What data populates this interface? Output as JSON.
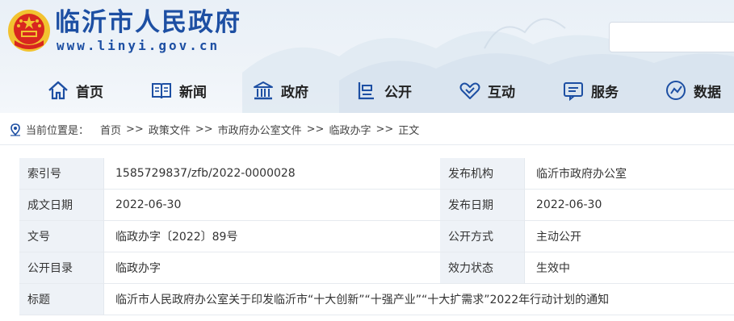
{
  "site": {
    "title": "临沂市人民政府",
    "url": "www.linyi.gov.cn"
  },
  "nav": [
    {
      "label": "首页",
      "icon": "home-icon"
    },
    {
      "label": "新闻",
      "icon": "news-icon"
    },
    {
      "label": "政府",
      "icon": "government-building-icon"
    },
    {
      "label": "公开",
      "icon": "open-info-icon"
    },
    {
      "label": "互动",
      "icon": "handshake-icon"
    },
    {
      "label": "服务",
      "icon": "service-icon"
    },
    {
      "label": "数据",
      "icon": "data-icon"
    }
  ],
  "breadcrumb": {
    "prefix": "当前位置是：",
    "items": [
      "首页",
      "政策文件",
      "市政府办公室文件",
      "临政办字",
      "正文"
    ],
    "separator": ">>"
  },
  "info": {
    "rows": [
      {
        "label1": "索引号",
        "value1": "1585729837/zfb/2022-0000028",
        "label2": "发布机构",
        "value2": "临沂市政府办公室"
      },
      {
        "label1": "成文日期",
        "value1": "2022-06-30",
        "label2": "发布日期",
        "value2": "2022-06-30"
      },
      {
        "label1": "文号",
        "value1": "临政办字〔2022〕89号",
        "label2": "公开方式",
        "value2": "主动公开"
      },
      {
        "label1": "公开目录",
        "value1": "临政办字",
        "label2": "效力状态",
        "value2": "生效中"
      }
    ],
    "title_label": "标题",
    "title_value": "临沂市人民政府办公室关于印发临沂市“十大创新”“十强产业”“十大扩需求”2022年行动计划的通知"
  },
  "colors": {
    "brand_blue": "#1d4fa3",
    "label_bg": "#eef2f7",
    "emblem_red": "#d8261f",
    "emblem_gold": "#f2c230"
  }
}
